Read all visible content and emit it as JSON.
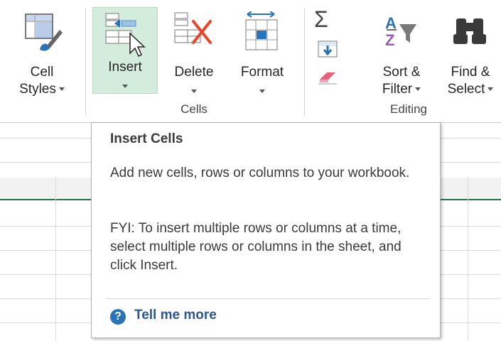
{
  "ribbon": {
    "buttons": [
      {
        "id": "cell_styles",
        "label_line1": "Cell",
        "label_line2": "Styles"
      },
      {
        "id": "insert",
        "label": "Insert"
      },
      {
        "id": "delete",
        "label": "Delete"
      },
      {
        "id": "format",
        "label": "Format"
      },
      {
        "id": "sort_filter",
        "label_line1": "Sort &",
        "label_line2": "Filter"
      },
      {
        "id": "find_select",
        "label_line1": "Find &",
        "label_line2": "Select"
      }
    ],
    "groups": {
      "cells": "Cells",
      "editing": "Editing"
    },
    "autosum_glyph": "Σ"
  },
  "tooltip": {
    "title": "Insert Cells",
    "description": "Add new cells, rows or columns to your workbook.",
    "fyi": "FYI: To insert multiple rows or columns at a time, select multiple rows or columns in the sheet, and click Insert.",
    "help_glyph": "?",
    "link_label": "Tell me more"
  },
  "colors": {
    "accent_green": "#217346",
    "insert_highlight": "#d4ecdc",
    "link_blue": "#2b5797",
    "help_blue": "#2b73b8",
    "delete_red": "#e8452c"
  }
}
